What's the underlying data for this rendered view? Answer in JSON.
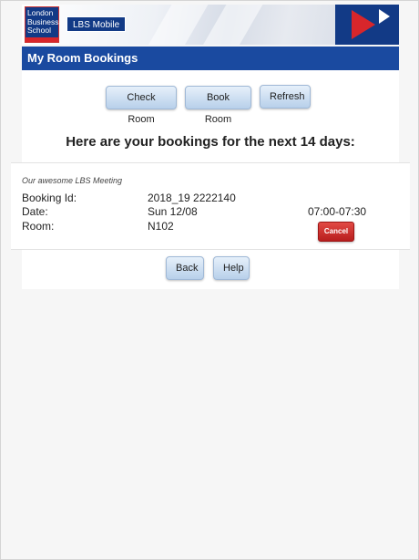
{
  "header": {
    "logo_text": "London Business School",
    "badge": "LBS Mobile",
    "title": "My Room Bookings"
  },
  "actions": {
    "check_room": "Check Room",
    "book_room": "Book Room",
    "refresh": "Refresh"
  },
  "heading": "Here are your bookings for the next 14 days:",
  "booking": {
    "meeting_name": "Our awesome LBS Meeting",
    "id_label": "Booking Id:",
    "id_value": "2018_19 2222140",
    "date_label": "Date:",
    "date_value": "Sun 12/08",
    "room_label": "Room:",
    "room_value": "N102",
    "time": "07:00-07:30",
    "cancel_label": "Cancel"
  },
  "footer": {
    "back": "Back",
    "help": "Help"
  },
  "colors": {
    "brand_blue": "#1a4aa0",
    "cancel_red": "#c8262b"
  }
}
